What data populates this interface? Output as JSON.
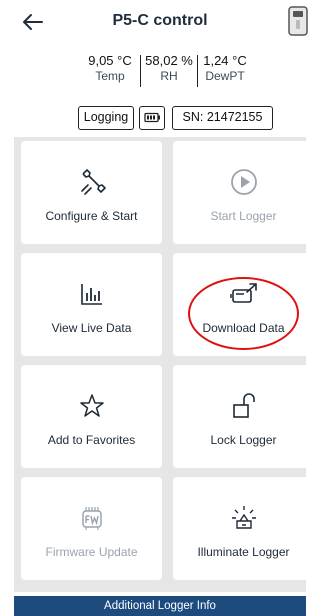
{
  "header": {
    "title": "P5-C control",
    "back_icon": "arrow-left-icon",
    "device_icon": "logger-device-icon"
  },
  "readings": [
    {
      "value": "9,05 °C",
      "label": "Temp"
    },
    {
      "value": "58,02 %",
      "label": "RH"
    },
    {
      "value": "1,24 °C",
      "label": "DewPT"
    }
  ],
  "status": {
    "logging": "Logging",
    "battery_icon": "battery-icon",
    "serial": "SN: 21472155"
  },
  "tiles": {
    "configure": {
      "label": "Configure & Start",
      "icon": "wrench-icon",
      "enabled": true
    },
    "start": {
      "label": "Start Logger",
      "icon": "play-icon",
      "enabled": false
    },
    "live": {
      "label": "View Live Data",
      "icon": "bar-chart-icon",
      "enabled": true
    },
    "download": {
      "label": "Download Data",
      "icon": "download-device-icon",
      "enabled": true
    },
    "favorites": {
      "label": "Add to Favorites",
      "icon": "star-icon",
      "enabled": true
    },
    "lock": {
      "label": "Lock Logger",
      "icon": "unlock-icon",
      "enabled": true
    },
    "firmware": {
      "label": "Firmware Update",
      "icon": "firmware-icon",
      "enabled": false
    },
    "illuminate": {
      "label": "Illuminate Logger",
      "icon": "light-icon",
      "enabled": true
    }
  },
  "footer": {
    "label": "Additional Logger Info"
  },
  "colors": {
    "accent": "#1d4b7e",
    "highlight": "#e01010",
    "tile_bg": "#ffffff",
    "grid_bg": "#e6e6e6"
  }
}
